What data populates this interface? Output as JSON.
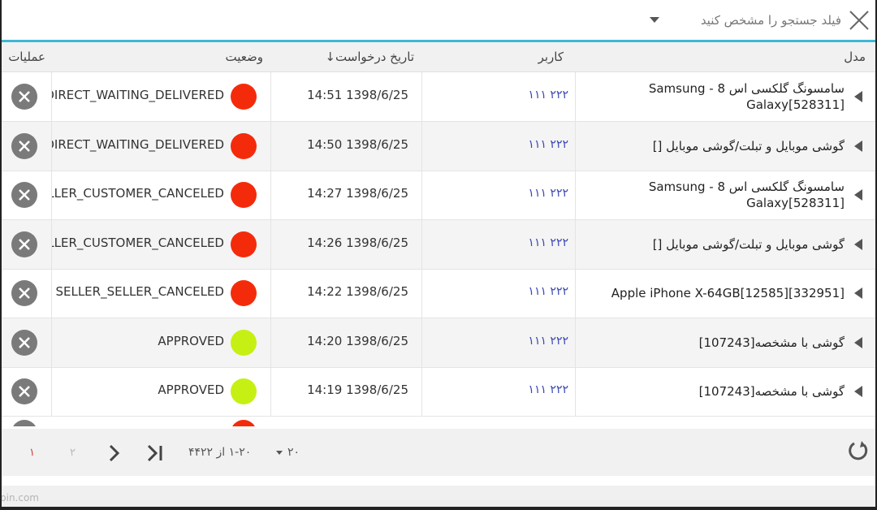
{
  "search": {
    "placeholder": "فیلد جستجو را مشخص کنید"
  },
  "columns": {
    "model": "مدل",
    "user": "کاربر",
    "date": "تاریخ درخواست",
    "status": "وضعیت",
    "ops": "عملیات"
  },
  "status_colors": {
    "red": "#f42b0b",
    "green": "#c6f014"
  },
  "rows": [
    {
      "model": "سامسونگ گلکسی اس 8 - Samsung Galaxy[528311]",
      "user": "۱۱۱ ۲۲۲",
      "date": "14:51 1398/6/25",
      "status": "DIRECT_WAITING_DELIVERED",
      "status_color": "red"
    },
    {
      "model": "گوشی موبایل و تبلت/گوشی موبایل []",
      "user": "۱۱۱ ۲۲۲",
      "date": "14:50 1398/6/25",
      "status": "DIRECT_WAITING_DELIVERED",
      "status_color": "red"
    },
    {
      "model": "سامسونگ گلکسی اس 8 - Samsung Galaxy[528311]",
      "user": "۱۱۱ ۲۲۲",
      "date": "14:27 1398/6/25",
      "status": "SELLER_CUSTOMER_CANCELED",
      "status_color": "red"
    },
    {
      "model": "گوشی موبایل و تبلت/گوشی موبایل []",
      "user": "۱۱۱ ۲۲۲",
      "date": "14:26 1398/6/25",
      "status": "SELLER_CUSTOMER_CANCELED",
      "status_color": "red"
    },
    {
      "model": "Apple iPhone X-64GB[12585][332951]",
      "user": "۱۱۱ ۲۲۲",
      "date": "14:22 1398/6/25",
      "status": "SELLER_SELLER_CANCELED",
      "status_color": "red"
    },
    {
      "model": "گوشی با مشخصه[107243]",
      "user": "۱۱۱ ۲۲۲",
      "date": "14:20 1398/6/25",
      "status": "APPROVED",
      "status_color": "green"
    },
    {
      "model": "گوشی با مشخصه[107243]",
      "user": "۱۱۱ ۲۲۲",
      "date": "14:19 1398/6/25",
      "status": "APPROVED",
      "status_color": "green"
    }
  ],
  "pagination": {
    "page_size": "۲۰",
    "range": "۱-۲۰ از ۴۴۲۲",
    "pages": [
      "۱",
      "۲"
    ]
  },
  "watermark": "pin.com"
}
